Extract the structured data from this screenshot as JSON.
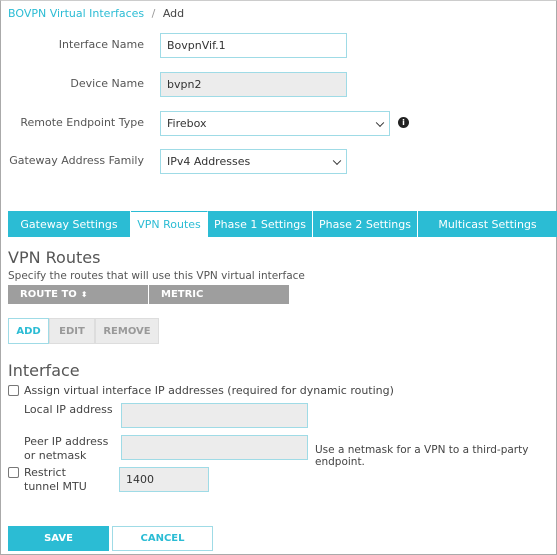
{
  "breadcrumb": {
    "parent": "BOVPN Virtual Interfaces",
    "separator": "/",
    "current": "Add"
  },
  "form": {
    "interface_name": {
      "label": "Interface Name",
      "value": "BovpnVif.1"
    },
    "device_name": {
      "label": "Device Name",
      "value": "bvpn2"
    },
    "remote_endpoint_type": {
      "label": "Remote Endpoint Type",
      "value": "Firebox"
    },
    "gateway_address_family": {
      "label": "Gateway Address Family",
      "value": "IPv4 Addresses"
    }
  },
  "tabs": [
    {
      "label": "Gateway Settings"
    },
    {
      "label": "VPN Routes",
      "active": true
    },
    {
      "label": "Phase 1 Settings"
    },
    {
      "label": "Phase 2 Settings"
    },
    {
      "label": "Multicast Settings"
    }
  ],
  "routes": {
    "title": "VPN Routes",
    "description": "Specify the routes that will use this VPN virtual interface",
    "columns": [
      "ROUTE TO",
      "METRIC"
    ],
    "add": "ADD",
    "edit": "EDIT",
    "remove": "REMOVE"
  },
  "interface": {
    "title": "Interface",
    "assign_label": "Assign virtual interface IP addresses (required for dynamic routing)",
    "assign_checked": false,
    "local_ip_label": "Local IP address",
    "local_ip_value": "",
    "peer_ip_label": "Peer IP address or netmask",
    "peer_ip_value": "",
    "peer_hint": "Use a netmask for a VPN to a third-party endpoint.",
    "mtu_label": "Restrict tunnel MTU",
    "mtu_checked": false,
    "mtu_value": "1400"
  },
  "actions": {
    "save": "SAVE",
    "cancel": "CANCEL"
  },
  "colors": {
    "accent": "#2bbcd4",
    "header_gray": "#9e9e9e"
  }
}
